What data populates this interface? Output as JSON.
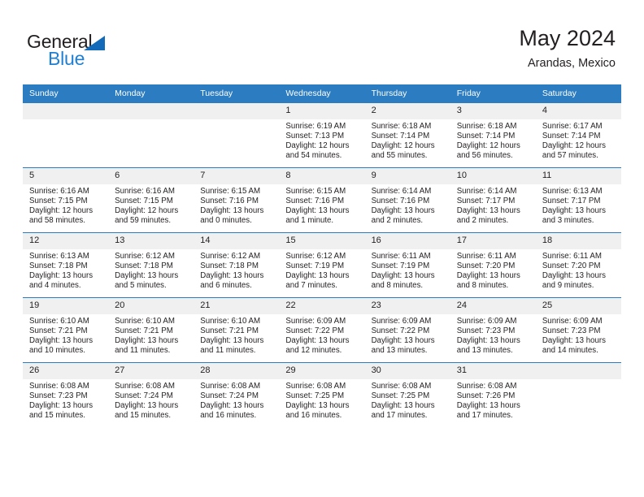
{
  "brand": {
    "name_primary": "General",
    "name_secondary": "Blue",
    "accent_color": "#1f7fd4",
    "triangle_color": "#136ab8"
  },
  "header": {
    "title": "May 2024",
    "subtitle": "Arandas, Mexico"
  },
  "calendar": {
    "header_bg": "#2b7cc0",
    "daynum_bg": "#f0f0f0",
    "weekday_headers": [
      "Sunday",
      "Monday",
      "Tuesday",
      "Wednesday",
      "Thursday",
      "Friday",
      "Saturday"
    ],
    "weeks": [
      [
        {
          "day": "",
          "lines": []
        },
        {
          "day": "",
          "lines": []
        },
        {
          "day": "",
          "lines": []
        },
        {
          "day": "1",
          "lines": [
            "Sunrise: 6:19 AM",
            "Sunset: 7:13 PM",
            "Daylight: 12 hours",
            "and 54 minutes."
          ]
        },
        {
          "day": "2",
          "lines": [
            "Sunrise: 6:18 AM",
            "Sunset: 7:14 PM",
            "Daylight: 12 hours",
            "and 55 minutes."
          ]
        },
        {
          "day": "3",
          "lines": [
            "Sunrise: 6:18 AM",
            "Sunset: 7:14 PM",
            "Daylight: 12 hours",
            "and 56 minutes."
          ]
        },
        {
          "day": "4",
          "lines": [
            "Sunrise: 6:17 AM",
            "Sunset: 7:14 PM",
            "Daylight: 12 hours",
            "and 57 minutes."
          ]
        }
      ],
      [
        {
          "day": "5",
          "lines": [
            "Sunrise: 6:16 AM",
            "Sunset: 7:15 PM",
            "Daylight: 12 hours",
            "and 58 minutes."
          ]
        },
        {
          "day": "6",
          "lines": [
            "Sunrise: 6:16 AM",
            "Sunset: 7:15 PM",
            "Daylight: 12 hours",
            "and 59 minutes."
          ]
        },
        {
          "day": "7",
          "lines": [
            "Sunrise: 6:15 AM",
            "Sunset: 7:16 PM",
            "Daylight: 13 hours",
            "and 0 minutes."
          ]
        },
        {
          "day": "8",
          "lines": [
            "Sunrise: 6:15 AM",
            "Sunset: 7:16 PM",
            "Daylight: 13 hours",
            "and 1 minute."
          ]
        },
        {
          "day": "9",
          "lines": [
            "Sunrise: 6:14 AM",
            "Sunset: 7:16 PM",
            "Daylight: 13 hours",
            "and 2 minutes."
          ]
        },
        {
          "day": "10",
          "lines": [
            "Sunrise: 6:14 AM",
            "Sunset: 7:17 PM",
            "Daylight: 13 hours",
            "and 2 minutes."
          ]
        },
        {
          "day": "11",
          "lines": [
            "Sunrise: 6:13 AM",
            "Sunset: 7:17 PM",
            "Daylight: 13 hours",
            "and 3 minutes."
          ]
        }
      ],
      [
        {
          "day": "12",
          "lines": [
            "Sunrise: 6:13 AM",
            "Sunset: 7:18 PM",
            "Daylight: 13 hours",
            "and 4 minutes."
          ]
        },
        {
          "day": "13",
          "lines": [
            "Sunrise: 6:12 AM",
            "Sunset: 7:18 PM",
            "Daylight: 13 hours",
            "and 5 minutes."
          ]
        },
        {
          "day": "14",
          "lines": [
            "Sunrise: 6:12 AM",
            "Sunset: 7:18 PM",
            "Daylight: 13 hours",
            "and 6 minutes."
          ]
        },
        {
          "day": "15",
          "lines": [
            "Sunrise: 6:12 AM",
            "Sunset: 7:19 PM",
            "Daylight: 13 hours",
            "and 7 minutes."
          ]
        },
        {
          "day": "16",
          "lines": [
            "Sunrise: 6:11 AM",
            "Sunset: 7:19 PM",
            "Daylight: 13 hours",
            "and 8 minutes."
          ]
        },
        {
          "day": "17",
          "lines": [
            "Sunrise: 6:11 AM",
            "Sunset: 7:20 PM",
            "Daylight: 13 hours",
            "and 8 minutes."
          ]
        },
        {
          "day": "18",
          "lines": [
            "Sunrise: 6:11 AM",
            "Sunset: 7:20 PM",
            "Daylight: 13 hours",
            "and 9 minutes."
          ]
        }
      ],
      [
        {
          "day": "19",
          "lines": [
            "Sunrise: 6:10 AM",
            "Sunset: 7:21 PM",
            "Daylight: 13 hours",
            "and 10 minutes."
          ]
        },
        {
          "day": "20",
          "lines": [
            "Sunrise: 6:10 AM",
            "Sunset: 7:21 PM",
            "Daylight: 13 hours",
            "and 11 minutes."
          ]
        },
        {
          "day": "21",
          "lines": [
            "Sunrise: 6:10 AM",
            "Sunset: 7:21 PM",
            "Daylight: 13 hours",
            "and 11 minutes."
          ]
        },
        {
          "day": "22",
          "lines": [
            "Sunrise: 6:09 AM",
            "Sunset: 7:22 PM",
            "Daylight: 13 hours",
            "and 12 minutes."
          ]
        },
        {
          "day": "23",
          "lines": [
            "Sunrise: 6:09 AM",
            "Sunset: 7:22 PM",
            "Daylight: 13 hours",
            "and 13 minutes."
          ]
        },
        {
          "day": "24",
          "lines": [
            "Sunrise: 6:09 AM",
            "Sunset: 7:23 PM",
            "Daylight: 13 hours",
            "and 13 minutes."
          ]
        },
        {
          "day": "25",
          "lines": [
            "Sunrise: 6:09 AM",
            "Sunset: 7:23 PM",
            "Daylight: 13 hours",
            "and 14 minutes."
          ]
        }
      ],
      [
        {
          "day": "26",
          "lines": [
            "Sunrise: 6:08 AM",
            "Sunset: 7:23 PM",
            "Daylight: 13 hours",
            "and 15 minutes."
          ]
        },
        {
          "day": "27",
          "lines": [
            "Sunrise: 6:08 AM",
            "Sunset: 7:24 PM",
            "Daylight: 13 hours",
            "and 15 minutes."
          ]
        },
        {
          "day": "28",
          "lines": [
            "Sunrise: 6:08 AM",
            "Sunset: 7:24 PM",
            "Daylight: 13 hours",
            "and 16 minutes."
          ]
        },
        {
          "day": "29",
          "lines": [
            "Sunrise: 6:08 AM",
            "Sunset: 7:25 PM",
            "Daylight: 13 hours",
            "and 16 minutes."
          ]
        },
        {
          "day": "30",
          "lines": [
            "Sunrise: 6:08 AM",
            "Sunset: 7:25 PM",
            "Daylight: 13 hours",
            "and 17 minutes."
          ]
        },
        {
          "day": "31",
          "lines": [
            "Sunrise: 6:08 AM",
            "Sunset: 7:26 PM",
            "Daylight: 13 hours",
            "and 17 minutes."
          ]
        },
        {
          "day": "",
          "lines": []
        }
      ]
    ]
  }
}
